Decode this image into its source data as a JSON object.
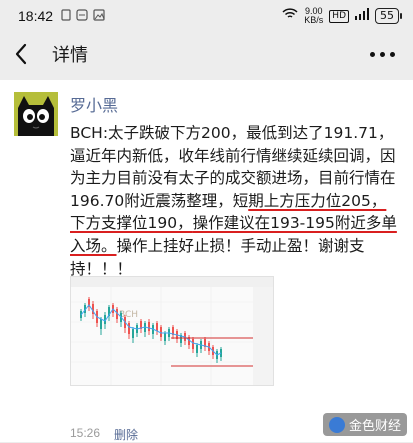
{
  "status_bar": {
    "time": "18:42",
    "network_speed": "9.00",
    "network_unit": "KB/s",
    "network_type": "HD",
    "battery": "55"
  },
  "nav": {
    "title": "详情"
  },
  "post": {
    "author": "罗小黑",
    "content_part1": "BCH:太子跌破下方200，最低到达了191.71，逼近年内新低，收年线前行情继续延续回调，因为主力目前没有太子的成交额进场，目前行情在196.70附近震荡整理，短",
    "content_part2": "期上方压力位205，下方支撑位190，",
    "content_part3": "操作建议在193-195附近多单入场。",
    "content_part4": "操作上挂好止损！手动止盈！谢谢支持！！！",
    "chart_watermark": "BCH",
    "timestamp": "15:26",
    "delete_label": "删除"
  },
  "watermark": {
    "text": "金色财经"
  },
  "colors": {
    "link": "#576b95",
    "underline": "#d91f1f",
    "avatar_bg": "#b5be3a"
  }
}
